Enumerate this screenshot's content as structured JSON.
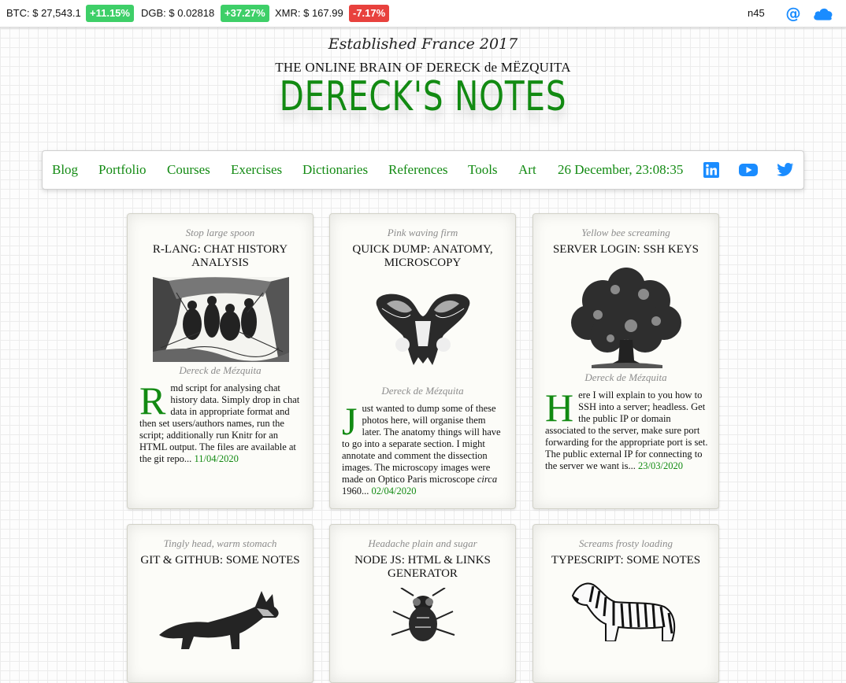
{
  "ticker": {
    "items": [
      {
        "label": "BTC: $ 27,543.1",
        "change": "+11.15%",
        "dir": "up"
      },
      {
        "label": "DGB: $ 0.02818",
        "change": "+37.27%",
        "dir": "up"
      },
      {
        "label": "XMR: $ 167.99",
        "change": "-7.17%",
        "dir": "down"
      }
    ],
    "user": "n45"
  },
  "header": {
    "established": "Established France 2017",
    "subtitle": "THE ONLINE BRAIN OF DERECK de MËZQUITA",
    "title": "DERECK'S NOTES"
  },
  "nav": {
    "links": [
      "Blog",
      "Portfolio",
      "Courses",
      "Exercises",
      "Dictionaries",
      "References",
      "Tools",
      "Art"
    ],
    "datetime": "26 December, 23:08:35",
    "social": [
      "linkedin-icon",
      "youtube-icon",
      "twitter-icon"
    ]
  },
  "colors": {
    "accent": "#128a12",
    "up": "#3ecf68",
    "down": "#e8413d",
    "link_blue": "#1a8cff"
  },
  "cards": [
    {
      "kicker": "Stop large spoon",
      "title": "R-LANG: CHAT HISTORY ANALYSIS",
      "image": "party-engraving",
      "author": "Dereck de Mézquita",
      "dropcap": "R",
      "text": "md script for analysing chat history data. Simply drop in chat data in appropriate format and then set users/authors names, run the script; additionally run Knitr for an HTML output. The files are available at the git repo...",
      "date": "11/04/2020"
    },
    {
      "kicker": "Pink waving firm",
      "title": "QUICK DUMP: ANATOMY, MICROSCOPY",
      "image": "pelvis-engraving",
      "author": "Dereck de Mézquita",
      "dropcap": "J",
      "text_before": "ust wanted to dump some of these photos here, will organise them later. The anatomy things will have to go into a separate section. I might annotate and comment the dissection images. The microscopy images were made on Optico Paris microscope ",
      "text_em": "circa",
      "text_after": " 1960...",
      "date": "02/04/2020"
    },
    {
      "kicker": "Yellow bee screaming",
      "title": "SERVER LOGIN: SSH KEYS",
      "image": "oak-tree-engraving",
      "author": "Dereck de Mézquita",
      "dropcap": "H",
      "text": "ere I will explain to you how to SSH into a server; headless. Get the public IP or domain associated to the server, make sure port forwarding for the appropriate port is set. The public external IP for connecting to the server we want is...",
      "date": "23/03/2020"
    },
    {
      "kicker": "Tingly head, warm stomach",
      "title": "GIT & GITHUB: SOME NOTES",
      "image": "fox-engraving"
    },
    {
      "kicker": "Headache plain and sugar",
      "title": "NODE JS: HTML & LINKS GENERATOR",
      "image": "fly-engraving"
    },
    {
      "kicker": "Screams frosty loading",
      "title": "TYPESCRIPT: SOME NOTES",
      "image": "zebra-engraving"
    }
  ]
}
